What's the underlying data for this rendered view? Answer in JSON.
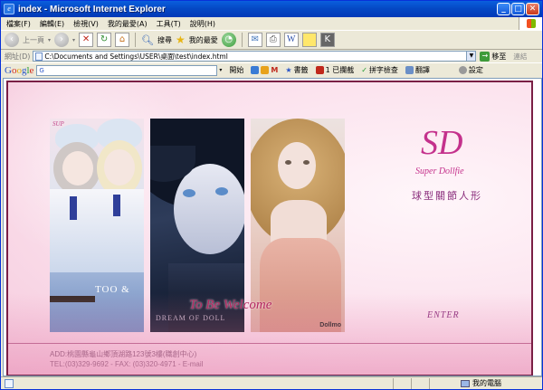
{
  "window": {
    "title": "index - Microsoft Internet Explorer"
  },
  "menu": [
    "檔案(F)",
    "編輯(E)",
    "檢視(V)",
    "我的最愛(A)",
    "工具(T)",
    "說明(H)"
  ],
  "toolbar": {
    "back": "上一頁",
    "search": "搜尋",
    "favorites": "我的最愛"
  },
  "address": {
    "label": "網址(D)",
    "url": "C:\\Documents and Settings\\USER\\桌面\\test\\index.html",
    "go": "移至",
    "links": "連結"
  },
  "google": {
    "logo": "Google",
    "search_prefix": "G",
    "go": "開始",
    "bookmarks": "書籤",
    "blocked": "1 已攔截",
    "spellcheck": "拼字檢查",
    "translate": "翻譯",
    "settings": "設定"
  },
  "page": {
    "sup_tag": "SUP",
    "too_text": "TOO &",
    "dream_text": "DREAM OF DOLL",
    "welcome": "To Be Welcome",
    "dollmo": "Dollmo",
    "brand_logo": "SD",
    "brand_sub": "Super Dollfie",
    "brand_cn": "球型關節人形",
    "enter": "ENTER",
    "address_line": "ADD:桃園縣龜山鄉頂湖路123號3樓(職創中心)",
    "contact_line": "TEL:(03)329-9692  -  FAX:  (03)320-4971 - E-mail"
  },
  "status": {
    "zone": "我的電腦"
  }
}
